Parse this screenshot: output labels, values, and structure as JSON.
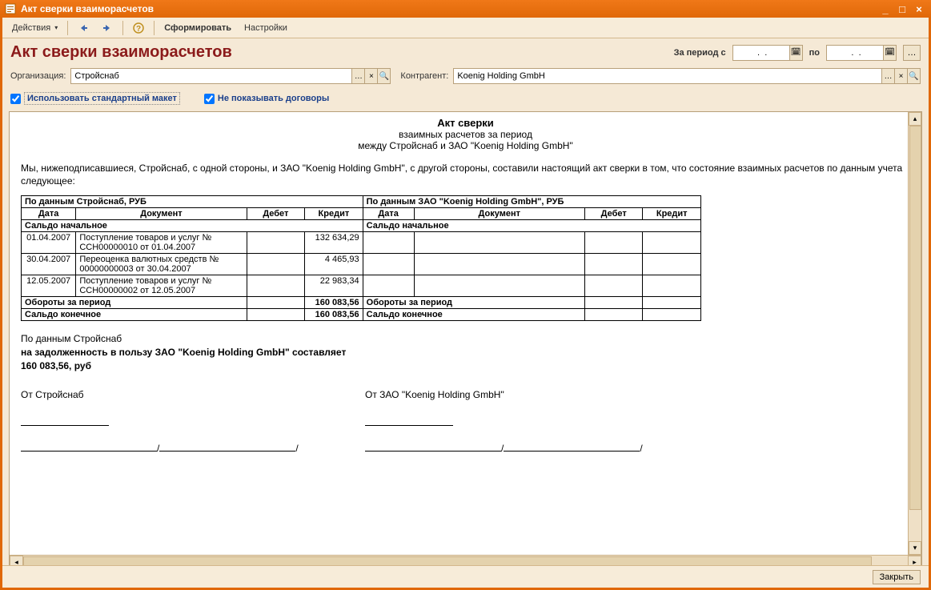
{
  "window": {
    "title": "Акт сверки взаиморасчетов"
  },
  "toolbar": {
    "actions": "Действия",
    "form": "Сформировать",
    "settings": "Настройки"
  },
  "header": {
    "title": "Акт сверки взаиморасчетов",
    "period_from": "За период с",
    "period_to": "по",
    "date_from": " .  .",
    "date_to": " .  ."
  },
  "form": {
    "org_label": "Организация:",
    "org_value": "Стройснаб",
    "counterparty_label": "Контрагент:",
    "counterparty_value": "Koenig Holding GmbH"
  },
  "checks": {
    "use_standard": "Использовать стандартный макет",
    "hide_contracts": "Не показывать договоры"
  },
  "doc": {
    "title": "Акт сверки",
    "sub1": "взаимных расчетов за период",
    "sub2": "между Стройснаб и ЗАО \"Koenig Holding GmbH\"",
    "intro": "Мы, нижеподписавшиеся, Стройснаб, с одной стороны, и ЗАО \"Koenig Holding GmbH\", с другой стороны, составили настоящий акт сверки в том, что состояние взаимных расчетов по данным учета следующее:",
    "group1": "По данным Стройснаб, РУБ",
    "group2": "По данным ЗАО \"Koenig Holding GmbH\", РУБ",
    "col_date": "Дата",
    "col_doc": "Документ",
    "col_debit": "Дебет",
    "col_credit": "Кредит",
    "saldo_start": "Сальдо начальное",
    "turnover": "Обороты за период",
    "saldo_end": "Сальдо конечное",
    "rows": [
      {
        "date": "01.04.2007",
        "doc": "Поступление товаров и услуг № ССН00000010 от 01.04.2007",
        "debit": "",
        "credit": "132 634,29"
      },
      {
        "date": "30.04.2007",
        "doc": "Переоценка валютных средств № 00000000003 от 30.04.2007",
        "debit": "",
        "credit": "4 465,93"
      },
      {
        "date": "12.05.2007",
        "doc": "Поступление товаров и услуг № ССН00000002 от 12.05.2007",
        "debit": "",
        "credit": "22 983,34"
      }
    ],
    "turnover_credit": "160 083,56",
    "saldo_end_credit": "160 083,56",
    "post1": "По данным Стройснаб",
    "post2": "на  задолженность в пользу ЗАО \"Koenig Holding GmbH\" составляет",
    "post3": "160 083,56, руб",
    "sign_from1": "От Стройснаб",
    "sign_from2": "От ЗАО \"Koenig Holding GmbH\""
  },
  "footer": {
    "close": "Закрыть"
  }
}
